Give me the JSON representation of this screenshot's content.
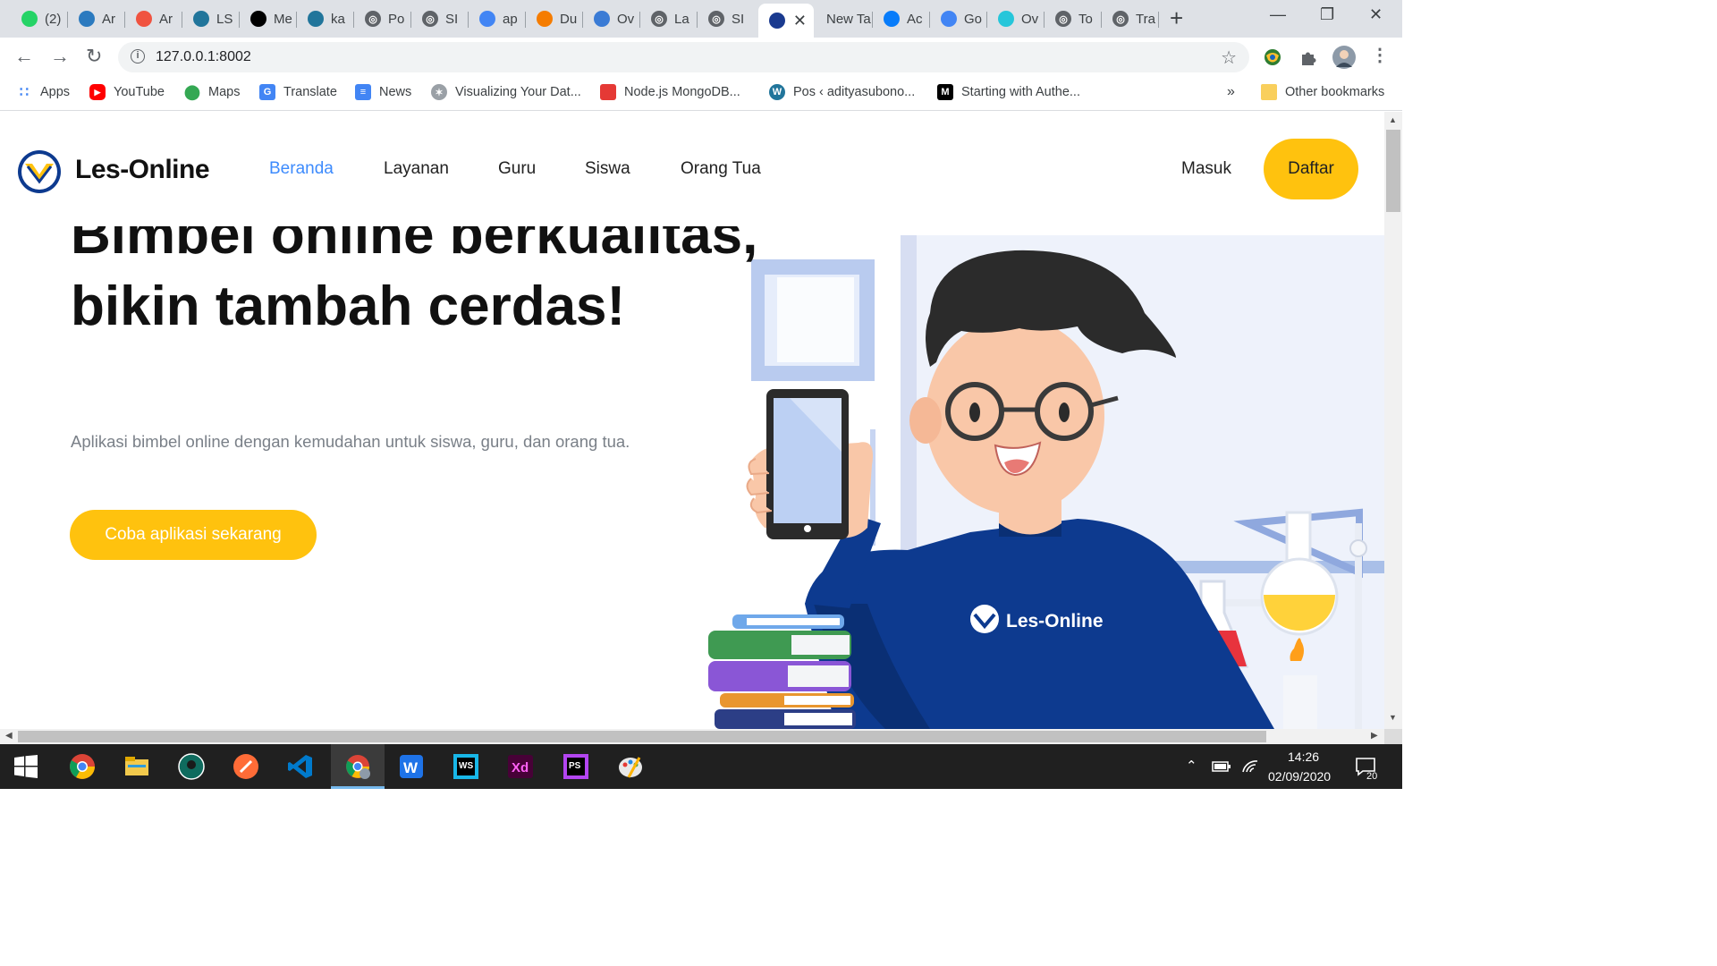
{
  "browser": {
    "tabs": [
      {
        "label": "(2)",
        "icon": "whatsapp-icon",
        "color": "#25d366"
      },
      {
        "label": "Ar",
        "icon": "anaconda-icon",
        "color": "#2b7abf"
      },
      {
        "label": "Ar",
        "icon": "laravel-icon",
        "color": "#f05340"
      },
      {
        "label": "LS",
        "icon": "wordpress-icon",
        "color": "#21759b"
      },
      {
        "label": "Me",
        "icon": "medium-icon",
        "color": "#000000"
      },
      {
        "label": "ka",
        "icon": "wordpress-icon",
        "color": "#21759b"
      },
      {
        "label": "Po",
        "icon": "globe-icon",
        "color": "#5f6368"
      },
      {
        "label": "SI",
        "icon": "globe-icon",
        "color": "#5f6368"
      },
      {
        "label": "ap",
        "icon": "google-icon",
        "color": "#4285f4"
      },
      {
        "label": "Du",
        "icon": "jh-icon",
        "color": "#f57c00"
      },
      {
        "label": "Ov",
        "icon": "unilexa-icon",
        "color": "#3a7bd5"
      },
      {
        "label": "La",
        "icon": "globe-icon",
        "color": "#5f6368"
      },
      {
        "label": "SI",
        "icon": "globe-icon",
        "color": "#5f6368"
      },
      {
        "label": "",
        "icon": "les-online-icon",
        "color": "#1a3a8f"
      },
      {
        "label": "New Ta",
        "icon": "",
        "color": ""
      },
      {
        "label": "Ac",
        "icon": "webstorm-icon",
        "color": "#087cfa"
      },
      {
        "label": "Go",
        "icon": "translate-icon",
        "color": "#4285f4"
      },
      {
        "label": "Ov",
        "icon": "ov-icon",
        "color": "#26c6da"
      },
      {
        "label": "To",
        "icon": "globe-icon",
        "color": "#5f6368"
      },
      {
        "label": "Tra",
        "icon": "globe-icon",
        "color": "#5f6368"
      }
    ],
    "url": "127.0.0.1:8002",
    "bookmarks": [
      {
        "label": "Apps",
        "icon": "apps-grid-icon",
        "color": "#4285f4"
      },
      {
        "label": "YouTube",
        "icon": "youtube-icon",
        "color": "#ff0000"
      },
      {
        "label": "Maps",
        "icon": "maps-pin-icon",
        "color": "#34a853"
      },
      {
        "label": "Translate",
        "icon": "translate-icon",
        "color": "#4285f4"
      },
      {
        "label": "News",
        "icon": "google-news-icon",
        "color": "#4285f4"
      },
      {
        "label": "Visualizing Your Dat...",
        "icon": "d3-icon",
        "color": "#9aa0a6"
      },
      {
        "label": "Node.js MongoDB...",
        "icon": "bezkoder-icon",
        "color": "#e53935"
      },
      {
        "label": "Pos ‹ adityasubono...",
        "icon": "wordpress-icon",
        "color": "#21759b"
      },
      {
        "label": "Starting with Authe...",
        "icon": "medium-icon",
        "color": "#000000"
      }
    ],
    "overflow": "»",
    "other_bookmarks": "Other bookmarks"
  },
  "site": {
    "brand": "Les-Online",
    "nav": [
      "Beranda",
      "Layanan",
      "Guru",
      "Siswa",
      "Orang Tua"
    ],
    "login": "Masuk",
    "register": "Daftar",
    "hero_title": "Bimbel online berkualitas, bikin tambah cerdas!",
    "hero_subtitle": "Aplikasi bimbel online dengan kemudahan untuk siswa, guru, dan orang tua.",
    "cta": "Coba aplikasi sekarang",
    "shirt_text": "Les-Online"
  },
  "colors": {
    "accent_yellow": "#ffc20e",
    "nav_active": "#3d8bfd",
    "brand_blue": "#0d3a8f"
  },
  "taskbar": {
    "time": "14:26",
    "date": "02/09/2020",
    "notifications": "20"
  }
}
